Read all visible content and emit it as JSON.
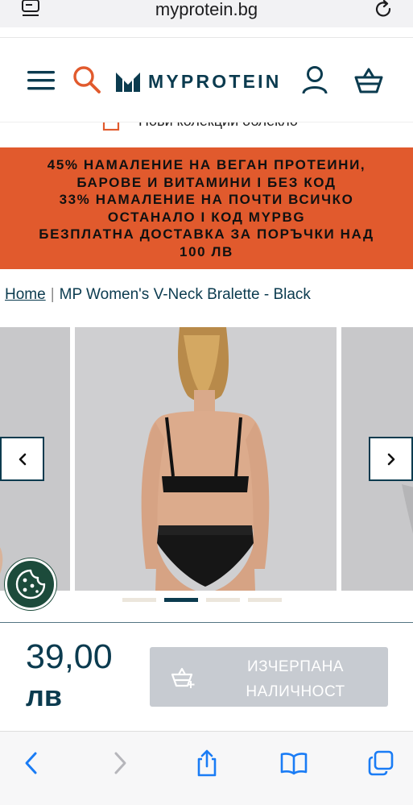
{
  "browser": {
    "url_host": "myprotein.bg"
  },
  "header": {
    "logo_text": "MYPROTEIN"
  },
  "collection_strip": {
    "text": "Нови колекции облекло"
  },
  "promo_banner": {
    "background": "#e15a2d",
    "lines": [
      "45% НАМАЛЕНИЕ НА ВЕГАН ПРОТЕИНИ,",
      "БАРОВЕ И ВИТАМИНИ I БЕЗ КОД",
      "33% НАМАЛЕНИЕ НА ПОЧТИ ВСИЧКО",
      "ОСТАНАЛО I КОД MYPBG",
      "БЕЗПЛАТНА ДОСТАВКА ЗА ПОРЪЧКИ НАД",
      "100 ЛВ"
    ]
  },
  "breadcrumb": {
    "home": "Home",
    "separator": "|",
    "current": "MP Women's V-Neck Bralette - Black"
  },
  "gallery": {
    "slide_count": 4,
    "active_index": 1
  },
  "product": {
    "price": "39,00",
    "currency": "лв",
    "cta_label": "ИЗЧЕРПАНА НАЛИЧНОСТ"
  },
  "colors": {
    "brand_navy": "#0b3b4f",
    "promo_orange": "#e15a2d",
    "safari_blue": "#1a7cf5",
    "cookie_green": "#1c4b3b"
  }
}
